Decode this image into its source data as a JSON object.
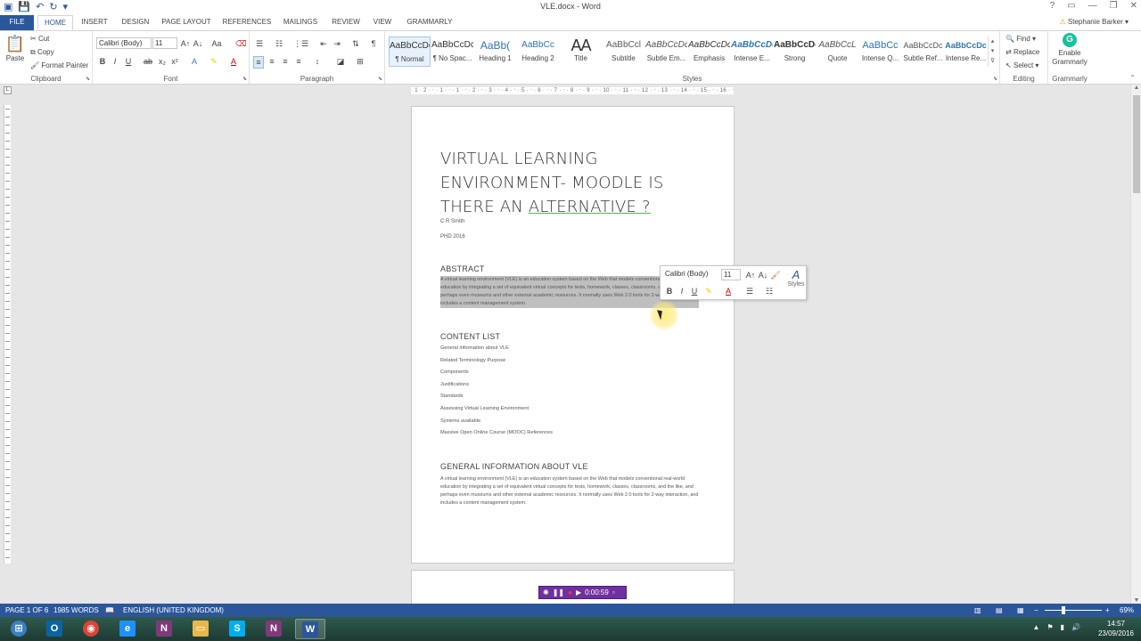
{
  "window": {
    "title": "VLE.docx - Word",
    "controls": [
      "?",
      "▭",
      "—",
      "❐",
      "✕"
    ]
  },
  "tabs": {
    "items": [
      "FILE",
      "HOME",
      "INSERT",
      "DESIGN",
      "PAGE LAYOUT",
      "REFERENCES",
      "MAILINGS",
      "REVIEW",
      "VIEW",
      "GRAMMARLY"
    ],
    "active": "HOME",
    "user": "Stephanie Barker"
  },
  "ribbon": {
    "clipboard": {
      "label": "Clipboard",
      "paste": "Paste",
      "cut": "Cut",
      "copy": "Copy",
      "format_painter": "Format Painter"
    },
    "font": {
      "label": "Font",
      "family": "Calibri (Body)",
      "size": "11",
      "case_btn": "Aa"
    },
    "paragraph": {
      "label": "Paragraph"
    },
    "styles": {
      "label": "Styles",
      "items": [
        {
          "preview": "AaBbCcDc",
          "name": "¶ Normal"
        },
        {
          "preview": "AaBbCcDc",
          "name": "¶ No Spac..."
        },
        {
          "preview": "AaBb(",
          "name": "Heading 1"
        },
        {
          "preview": "AaBbCc",
          "name": "Heading 2"
        },
        {
          "preview": "AA",
          "name": "Title"
        },
        {
          "preview": "AaBbCcl",
          "name": "Subtitle"
        },
        {
          "preview": "AaBbCcDc",
          "name": "Subtle Em..."
        },
        {
          "preview": "AaBbCcDc",
          "name": "Emphasis"
        },
        {
          "preview": "AaBbCcDc",
          "name": "Intense E..."
        },
        {
          "preview": "AaBbCcDc",
          "name": "Strong"
        },
        {
          "preview": "AaBbCcL",
          "name": "Quote"
        },
        {
          "preview": "AaBbCc",
          "name": "Intense Q..."
        },
        {
          "preview": "AaBbCcDc",
          "name": "Subtle Ref..."
        },
        {
          "preview": "AaBbCcDc",
          "name": "Intense Re..."
        }
      ]
    },
    "editing": {
      "label": "Editing",
      "find": "Find",
      "replace": "Replace",
      "select": "Select"
    },
    "grammarly": {
      "label": "Grammarly",
      "enable": "Enable",
      "grammarly": "Grammarly"
    }
  },
  "ruler": {
    "text": "· 1 · 2 · ‧ · 1 · ‧ · 1 · ‧ · 2 · ‧ · 3 · ‧ · 4 · ‧ · 5 · ‧ · 6 · ‧ · 7 · ‧ · 8 · ‧ · 9 · ‧ · 10 · ‧ · 11 · ‧ · 12 · ‧ · 13 · ‧ · 14 · ‧ · 15 · ‧ · 16 · ‧ · 17 · ‧ 18 · 19"
  },
  "document": {
    "title_line1": "VIRTUAL LEARNING",
    "title_line2": "ENVIRONMENT- MOODLE IS",
    "title_line3_a": "THERE AN ",
    "title_line3_b": "ALTERNATIVE ?",
    "author": "C R Smith",
    "degree": "PHD 2016",
    "abstract_heading": "ABSTRACT",
    "abstract_text": "A virtual learning environment (VLE) is an education system based on the Web that models conventional real-world education by integrating a set of equivalent virtual concepts for tests, homework, classes, classrooms, and the like, and perhaps even museums and other external academic resources. It normally uses Web 2.0 tools for 2-way interaction, and includes a content management system.",
    "content_heading": "CONTENT LIST",
    "content_items": [
      "General information about VLE",
      "Related Terminology Purpose",
      "Components",
      "Justifications",
      "Standards",
      "Assessing Virtual Learning Environment",
      "Systems available",
      "Massive Open Online Course (MOOC) References"
    ],
    "general_heading": "GENERAL INFORMATION ABOUT VLE",
    "general_text": "A virtual learning environment (VLE) is an education system based on the Web that models conventional real-world education by integrating a set of equivalent virtual concepts for tests, homework, classes, classrooms, and the like, and perhaps even museums and other external academic resources. It normally uses Web 2.0 tools for 2-way interaction, and includes a content management system."
  },
  "mini_toolbar": {
    "font": "Calibri (Body)",
    "size": "11",
    "styles": "Styles"
  },
  "recorder": {
    "time": "0:00:59"
  },
  "status": {
    "page": "PAGE 1 OF 6",
    "words": "1985 WORDS",
    "language": "ENGLISH (UNITED KINGDOM)",
    "zoom": "69%"
  },
  "taskbar": {
    "apps": [
      {
        "name": "windows-start",
        "glyph": "⊞",
        "color": "#3b7fc4"
      },
      {
        "name": "outlook",
        "glyph": "O",
        "color": "#0a64a4"
      },
      {
        "name": "chrome",
        "glyph": "◉",
        "color": "#db4437"
      },
      {
        "name": "internet-explorer",
        "glyph": "e",
        "color": "#1e90ff"
      },
      {
        "name": "onenote",
        "glyph": "N",
        "color": "#80397b"
      },
      {
        "name": "file-explorer",
        "glyph": "▭",
        "color": "#e8b84b"
      },
      {
        "name": "skype",
        "glyph": "S",
        "color": "#00aff0"
      },
      {
        "name": "onenote-2",
        "glyph": "N",
        "color": "#80397b"
      },
      {
        "name": "word",
        "glyph": "W",
        "color": "#2b579a"
      }
    ],
    "time": "14:57",
    "date": "23/09/2016"
  }
}
